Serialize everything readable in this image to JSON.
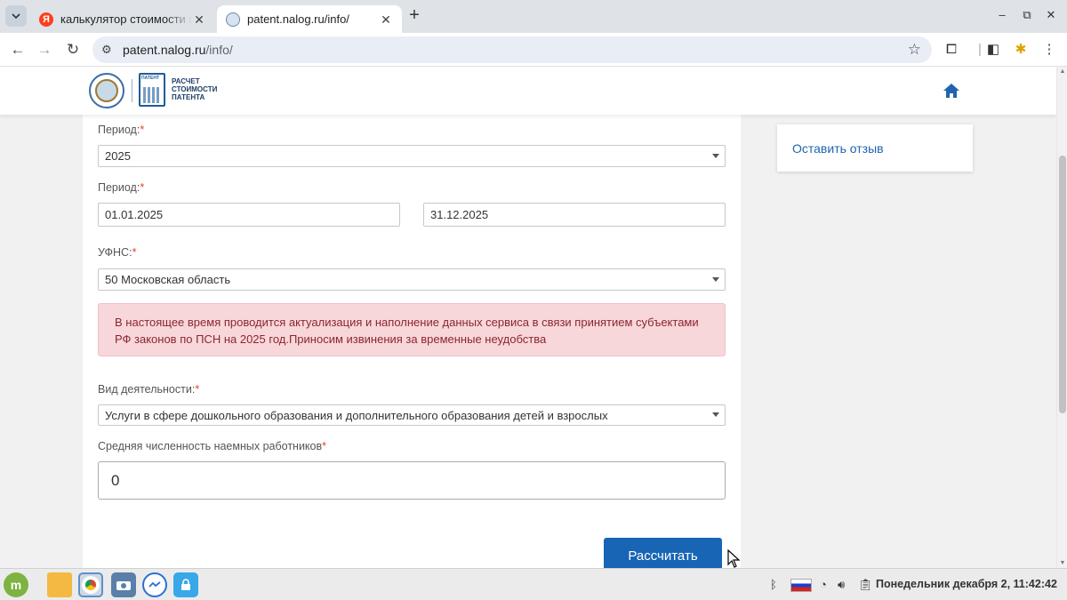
{
  "browser": {
    "tabs": [
      {
        "title": "калькулятор стоимости па",
        "favicon": "yandex-icon",
        "active": false
      },
      {
        "title": "patent.nalog.ru/info/",
        "favicon": "fns-icon",
        "active": true
      }
    ],
    "url_host": "patent.nalog.ru",
    "url_path": "/info/"
  },
  "site": {
    "brand": [
      "РАСЧЕТ",
      "СТОИМОСТИ",
      "ПАТЕНТА"
    ],
    "brand_logo_text": "ПАТЕНТ",
    "feedback_link": "Оставить отзыв"
  },
  "form": {
    "period_label": "Период:",
    "period_year": "2025",
    "period_range_label": "Период:",
    "date_from": "01.01.2025",
    "date_to": "31.12.2025",
    "ufns_label": "УФНС:",
    "ufns_value": "50 Московская область",
    "notice": "В настоящее время проводится актуализация и наполнение данных сервиса в связи принятием субъектами РФ законов по ПСН на 2025 год.Приносим извинения за временные неудобства",
    "activity_label": "Вид деятельности:",
    "activity_value": "Услуги в сфере дошкольного образования и дополнительного образования детей и взрослых",
    "employees_label": "Средняя численность наемных работников",
    "employees_value": "0",
    "required_mark": "*",
    "calculate_button": "Рассчитать"
  },
  "taskbar": {
    "clock": "Понедельник декабря  2, 11:42:42",
    "keyboard_layout": "ru"
  },
  "colors": {
    "accent": "#1865b5",
    "alert_bg": "#f8d7da",
    "alert_text": "#8b2630",
    "required": "#e0452b"
  }
}
